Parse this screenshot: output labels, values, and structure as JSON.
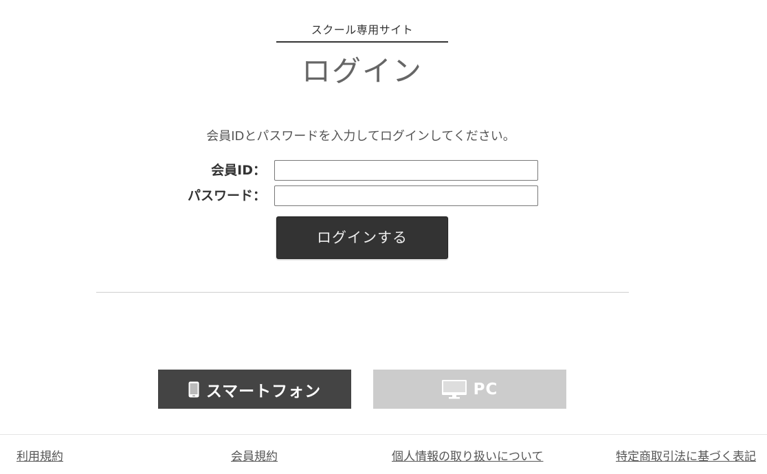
{
  "header": {
    "subtitle": "スクール専用サイト",
    "title": "ログイン"
  },
  "login": {
    "instruction": "会員IDとパスワードを入力してログインしてください。",
    "member_id_label": "会員ID：",
    "member_id_value": "",
    "password_label": "パスワード：",
    "password_value": "",
    "submit_label": "ログインする"
  },
  "view_switch": {
    "smartphone_label": "スマートフォン",
    "smartphone_icon": "smartphone-icon",
    "pc_label": "PC",
    "pc_icon": "monitor-icon",
    "active": "smartphone"
  },
  "footer": {
    "links": [
      "利用規約",
      "会員規約",
      "個人情報の取り扱いについて",
      "特定商取引法に基づく表記"
    ]
  },
  "colors": {
    "login_button_bg": "#333333",
    "smartphone_button_bg": "#444444",
    "pc_button_bg": "#cccccc"
  }
}
